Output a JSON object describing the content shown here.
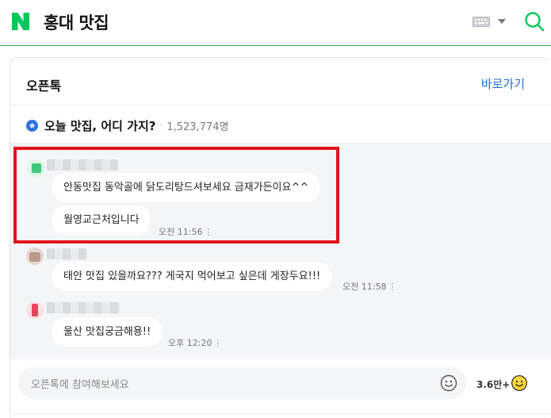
{
  "header": {
    "query": "홍대 맛집",
    "brand_color": "#03c75a"
  },
  "card": {
    "title": "오픈톡",
    "link_label": "바로가기",
    "room": {
      "name": "오늘 맛집, 어디 가지?",
      "separator": "·",
      "member_count": "1,523,774명"
    }
  },
  "messages": [
    {
      "bubbles": [
        "안동맛집 동악골에 닭도리탕드셔보세요 금재가든이요^^",
        "월영교근처입니다"
      ],
      "time": "오전 11:56",
      "more": "⋮"
    },
    {
      "bubbles": [
        "태안 맛집 있을까요??? 게국지 먹어보고 싶은데 게장두요!!!"
      ],
      "time": "오전 11:58",
      "more": "⋮"
    },
    {
      "bubbles": [
        "울산 맛집궁금해용!!"
      ],
      "time": "오후 12:20",
      "more": "⋮"
    }
  ],
  "input": {
    "placeholder": "오픈톡에 참여해보세요"
  },
  "participants_label": "3.6만+",
  "colors": {
    "highlight": "#e0141b",
    "link": "#1d6fd6",
    "chat_bg": "#f4f5f7"
  }
}
